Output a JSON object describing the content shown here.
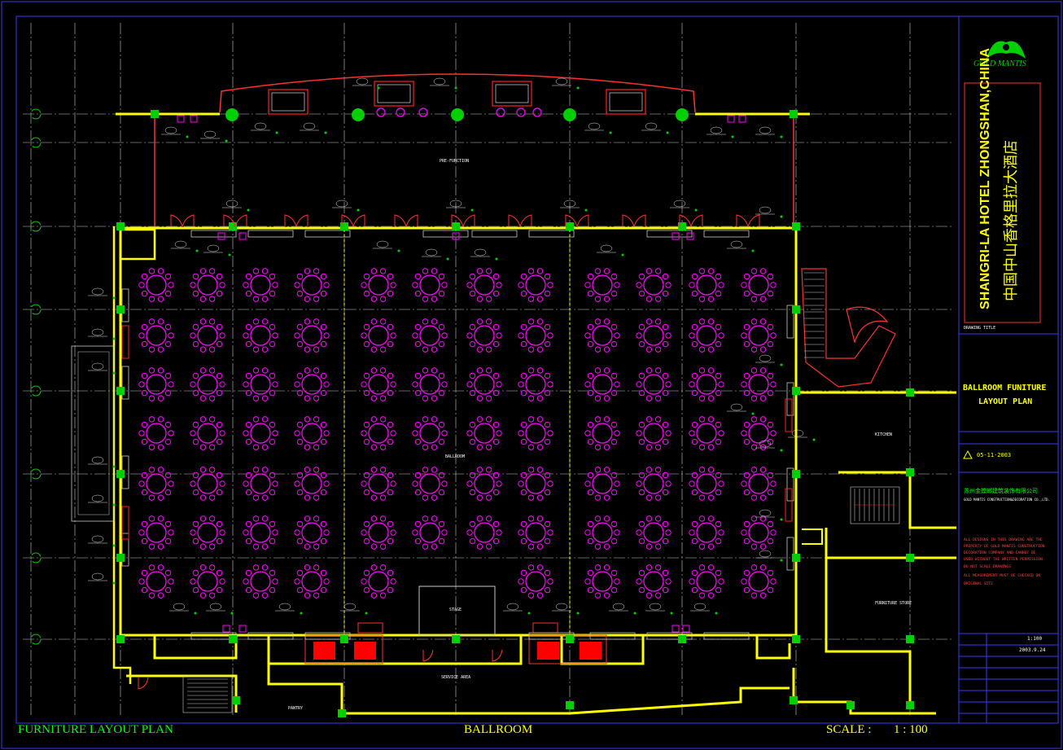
{
  "colors": {
    "background": "#000000",
    "wall": "#ffff00",
    "column": "#00d000",
    "furniture": "#ff00ff",
    "door": "#ff2020",
    "grid": "#c8c8c8",
    "frame": "#3a3aff",
    "title_box": "#ff3030",
    "text": "#ffff00"
  },
  "logo": {
    "text": "GOLD MANTIS",
    "icon": "mantis-logo-icon"
  },
  "project": {
    "name_en": "SHANGRI-LA HOTEL ZHONGSHAN,CHINA",
    "name_cn": "中国中山香格里拉大酒店",
    "drawing_title_label": "DRAWING TITLE"
  },
  "drawing": {
    "title_line1": "BALLROOM FUNITURE",
    "title_line2": "LAYOUT PLAN",
    "revision": "05-11-2003",
    "company_cn": "苏州金螳螂建筑装饰有限公司",
    "company_en": "GOLD MANTIS CONSTRUCTION&DECORATION CO.,LTD.",
    "notice": [
      "ALL DESIGNS IN THIS DRAWING ARE THE",
      "PROPERTY OF GOLD MANTIS CONSTRUCTION",
      "DECORATION COMPANY AND CANNOT BE",
      "USED WITHOUT THE WRITTEN PERMISSION",
      "DO NOT SCALE DRAWINGS",
      "ALL MEASUREMENT MUST BE CHECKED ON",
      "ORIGINAL SITE"
    ],
    "scale_value": "1:100",
    "date_value": "2003.9.24"
  },
  "rooms": {
    "pre_function": "PRE-FUNCTION",
    "ballroom": "BALLROOM",
    "stage": "STAGE",
    "kitchen": "KITCHEN",
    "furniture_store": "FURNITURE STORE",
    "service_area": "SERVICE AREA",
    "pantry": "PANTRY"
  },
  "footer": {
    "left": "FURNITURE LAYOUT PLAN",
    "center": "BALLROOM",
    "scale_label": "SCALE :",
    "scale_value": "1 : 100"
  },
  "furniture": {
    "round_table_rows": 7,
    "round_table_cols": 12
  }
}
